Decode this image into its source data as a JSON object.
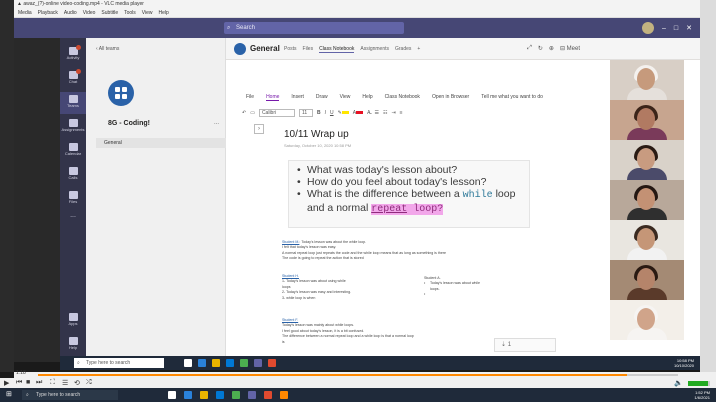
{
  "vlc": {
    "title": "▲ awaz_(?)-online video-coding.mp4 - VLC media player",
    "menu": [
      "Media",
      "Playback",
      "Audio",
      "Video",
      "Subtitle",
      "Tools",
      "View",
      "Help"
    ],
    "time_elapsed": "1:18",
    "time_total": "",
    "playback_fraction": 0.92,
    "volume_fraction": 0.9
  },
  "teams": {
    "search_placeholder": "Search",
    "back_label": "All teams",
    "team_name": "8G - Coding!",
    "team_more": "...",
    "channel": "General",
    "channel_title": "General",
    "channel_tabs": [
      "Posts",
      "Files",
      "Class Notebook",
      "Assignments",
      "Grades",
      "+"
    ],
    "active_tab_index": 2,
    "header_actions": [
      "⤢",
      "↻",
      "⊕",
      "⊟ Meet"
    ],
    "rail_items": [
      "Activity",
      "Chat",
      "Teams",
      "Assignments",
      "Calendar",
      "Calls",
      "Files",
      "...",
      "Apps",
      "Help"
    ]
  },
  "onenote": {
    "ribbon_tabs": [
      "File",
      "Home",
      "Insert",
      "Draw",
      "View",
      "Help",
      "Class Notebook",
      "Open in Browser",
      "Tell me what you want to do"
    ],
    "active_ribbon_index": 1,
    "font_name": "Calibri",
    "font_size": "11",
    "page_title": "10/11 Wrap up",
    "page_date": "Saturday, October 10, 2020    10:58 PM",
    "questions": [
      {
        "text": "What was today's lesson about?"
      },
      {
        "text": "How do you feel about today's lesson?"
      },
      {
        "pre": "What is the difference between a ",
        "kw1": "while",
        "mid": " loop and a normal ",
        "kw2": "repeat",
        "kw3": " loop?"
      }
    ],
    "notes": [
      {
        "name": "Student M.",
        "lines": [
          "Today's lesson was about the while loop.",
          "I felt that today's lesson was easy.",
          "A normal repeat loop just repeats the code and the while loop means that as long as something is there",
          "The code is going to repeat the action that is stored"
        ]
      },
      {
        "name": "Student H.",
        "lines": [
          "1- Today's lesson was about using while",
          "loops",
          "2- Today's lesson was easy and interesting.",
          "3- while loop is when"
        ]
      },
      {
        "name": "Student A.",
        "lines": [
          "Today's lesson was about while",
          "loops."
        ]
      },
      {
        "name": "Student F.",
        "lines": [
          "Today's lesson was mainly about while loops.",
          "I feel good about today's lesson, it is a bit confused.",
          "The difference between a normal repeat loop and a while loop is that a normal loop",
          "is"
        ]
      }
    ],
    "input_value": "1"
  },
  "participants": [
    {
      "bg": "#d8cfc6",
      "skin": "#c69a7c",
      "hair": "#f4f1ee",
      "top": "#e5e0db"
    },
    {
      "bg": "#c7a58f",
      "skin": "#b17a62",
      "hair": "#3b2419",
      "top": "#7a3a5a"
    },
    {
      "bg": "#d9d2c9",
      "skin": "#c89b80",
      "hair": "#2a1b14",
      "top": "#4b4b6a"
    },
    {
      "bg": "#b8a89a",
      "skin": "#c39174",
      "hair": "#241712",
      "top": "#2f2f2f"
    },
    {
      "bg": "#e9e6e0",
      "skin": "#c59677",
      "hair": "#3a2a20",
      "top": "#f2f2f2"
    },
    {
      "bg": "#a48a74",
      "skin": "#b5846a",
      "hair": "#2a1a12",
      "top": "#5a3a2a"
    },
    {
      "bg": "#f3efe9",
      "skin": "#d0a48a",
      "hair": "#f6f4f2",
      "top": "#f6f4f2"
    }
  ],
  "taskbar": {
    "inner_search": "Type here to search",
    "outer_search": "Type here to search",
    "inner_tray": "10:58 PM\n10/10/2020",
    "outer_tray": "1:52 PM\n1/6/2021"
  },
  "colors": {
    "teams_purple": "#464775",
    "accent": "#6264a7",
    "onenote_purple": "#7719aa",
    "vlc_orange": "#ff8800"
  }
}
